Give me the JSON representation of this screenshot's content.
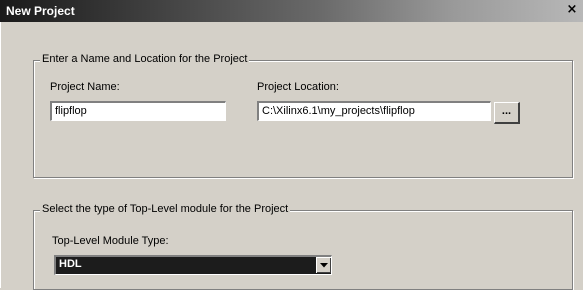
{
  "window": {
    "title": "New Project",
    "close_glyph": "×"
  },
  "name_location": {
    "legend": "Enter a Name and Location for the Project",
    "name_label": "Project Name:",
    "name_value": "flipflop",
    "location_label": "Project Location:",
    "location_value": "C:\\Xilinx6.1\\my_projects\\flipflop",
    "browse_label": "..."
  },
  "toplevel": {
    "legend": "Select the type of Top-Level module for the Project",
    "type_label": "Top-Level Module Type:",
    "type_value": "HDL"
  },
  "icons": {
    "close": "close-icon",
    "dropdown": "chevron-down-icon"
  }
}
